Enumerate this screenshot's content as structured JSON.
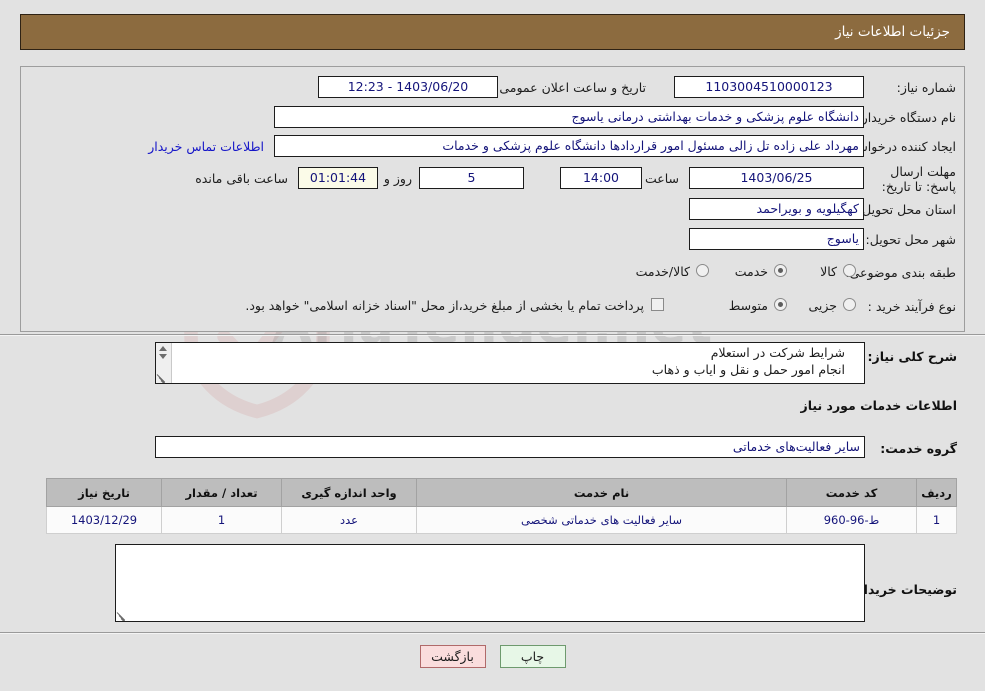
{
  "header": {
    "title": "جزئیات اطلاعات نیاز"
  },
  "form": {
    "need_number_label": "شماره نیاز:",
    "need_number_value": "1103004510000123",
    "announce_label": "تاریخ و ساعت اعلان عمومی:",
    "announce_value": "1403/06/20 - 12:23",
    "buyer_org_label": "نام دستگاه خریدار:",
    "buyer_org_value": "دانشگاه علوم پزشکی و خدمات بهداشتی  درمانی یاسوج",
    "creator_label": "ایجاد کننده درخواست:",
    "creator_value": "مهرداد علی زاده تل زالی مسئول امور قراردادها دانشگاه علوم پزشکی و خدمات",
    "contact_link": "اطلاعات تماس خریدار",
    "deadline_label": "مهلت ارسال پاسخ: تا تاریخ:",
    "deadline_date": "1403/06/25",
    "hour_label": "ساعت",
    "deadline_time": "14:00",
    "days_value": "5",
    "days_label": "روز و",
    "timer_value": "01:01:44",
    "remaining_label": "ساعت باقی مانده",
    "province_label": "استان محل تحویل:",
    "province_value": "کهگیلویه و بویراحمد",
    "city_label": "شهر محل تحویل:",
    "city_value": "یاسوج",
    "category_label": "طبقه بندی موضوعی:",
    "category_options": [
      "کالا",
      "خدمت",
      "کالا/خدمت"
    ],
    "category_selected_index": 1,
    "process_label": "نوع فرآیند خرید :",
    "process_options": [
      "جزیی",
      "متوسط"
    ],
    "process_selected_index": 1,
    "treasury_checkbox_label": "پرداخت تمام یا بخشی از مبلغ خرید،از محل \"اسناد خزانه اسلامی\" خواهد بود.",
    "treasury_checked": false
  },
  "description": {
    "label": "شرح کلی نیاز:",
    "value": "شرایط شرکت در استعلام\nانجام امور حمل و نقل و ایاب و ذهاب"
  },
  "services": {
    "section_title": "اطلاعات خدمات مورد نیاز",
    "group_label": "گروه خدمت:",
    "group_value": "سایر فعالیت‌های خدماتی",
    "table": {
      "columns": [
        "ردیف",
        "کد خدمت",
        "نام خدمت",
        "واحد اندازه گیری",
        "تعداد / مقدار",
        "تاریخ نیاز"
      ],
      "rows": [
        [
          "1",
          "ط-96-960",
          "سایر فعالیت های خدماتی شخصی",
          "عدد",
          "1",
          "1403/12/29"
        ]
      ]
    }
  },
  "buyer_notes": {
    "label": "توضیحات خریدار:",
    "value": ""
  },
  "buttons": {
    "back": "بازگشت",
    "print": "چاپ"
  },
  "watermark": {
    "text": "AriaTender.net"
  },
  "colors": {
    "header_band": "#8c6b3f",
    "field_text": "#14147a",
    "link": "#1515c8",
    "back_button": "#fadddd",
    "print_button": "#e7f7e7",
    "table_header": "#bdbdbd"
  }
}
